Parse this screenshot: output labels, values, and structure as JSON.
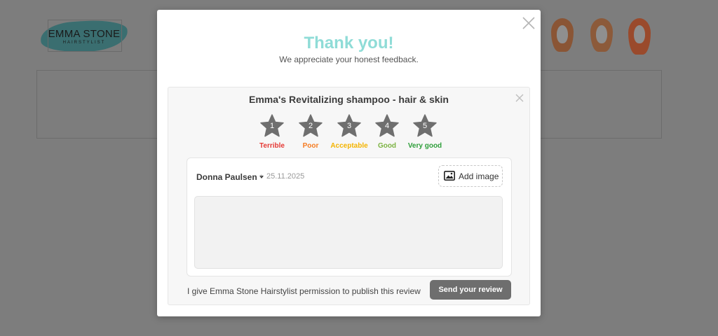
{
  "background": {
    "logo": {
      "name": "EMMA STONE",
      "subtitle": "HAIRSTYLIST"
    },
    "wig_icons": [
      "wig-icon",
      "wig-icon",
      "wig-icon"
    ]
  },
  "modal": {
    "title": "Thank you!",
    "subtitle": "We appreciate your honest feedback.",
    "close_icon": "close-icon",
    "accent_color": "#8fdcd7"
  },
  "review_card": {
    "product_name": "Emma's Revitalizing shampoo - hair & skin",
    "close_icon": "close-icon",
    "ratings": [
      {
        "number": "1",
        "label": "Terrible",
        "color": "#e53935"
      },
      {
        "number": "2",
        "label": "Poor",
        "color": "#f57c22"
      },
      {
        "number": "3",
        "label": "Acceptable",
        "color": "#f4b400"
      },
      {
        "number": "4",
        "label": "Good",
        "color": "#7cb342"
      },
      {
        "number": "5",
        "label": "Very good",
        "color": "#2e9e3a"
      }
    ],
    "selected_rating": null,
    "author": "Donna Paulsen",
    "separator": "•",
    "date": "25.11.2025",
    "add_image_label": "Add image",
    "add_image_icon": "image-icon",
    "review_text": "",
    "consent_text": "I give Emma Stone Hairstylist permission to publish this review",
    "submit_label": "Send your review"
  }
}
